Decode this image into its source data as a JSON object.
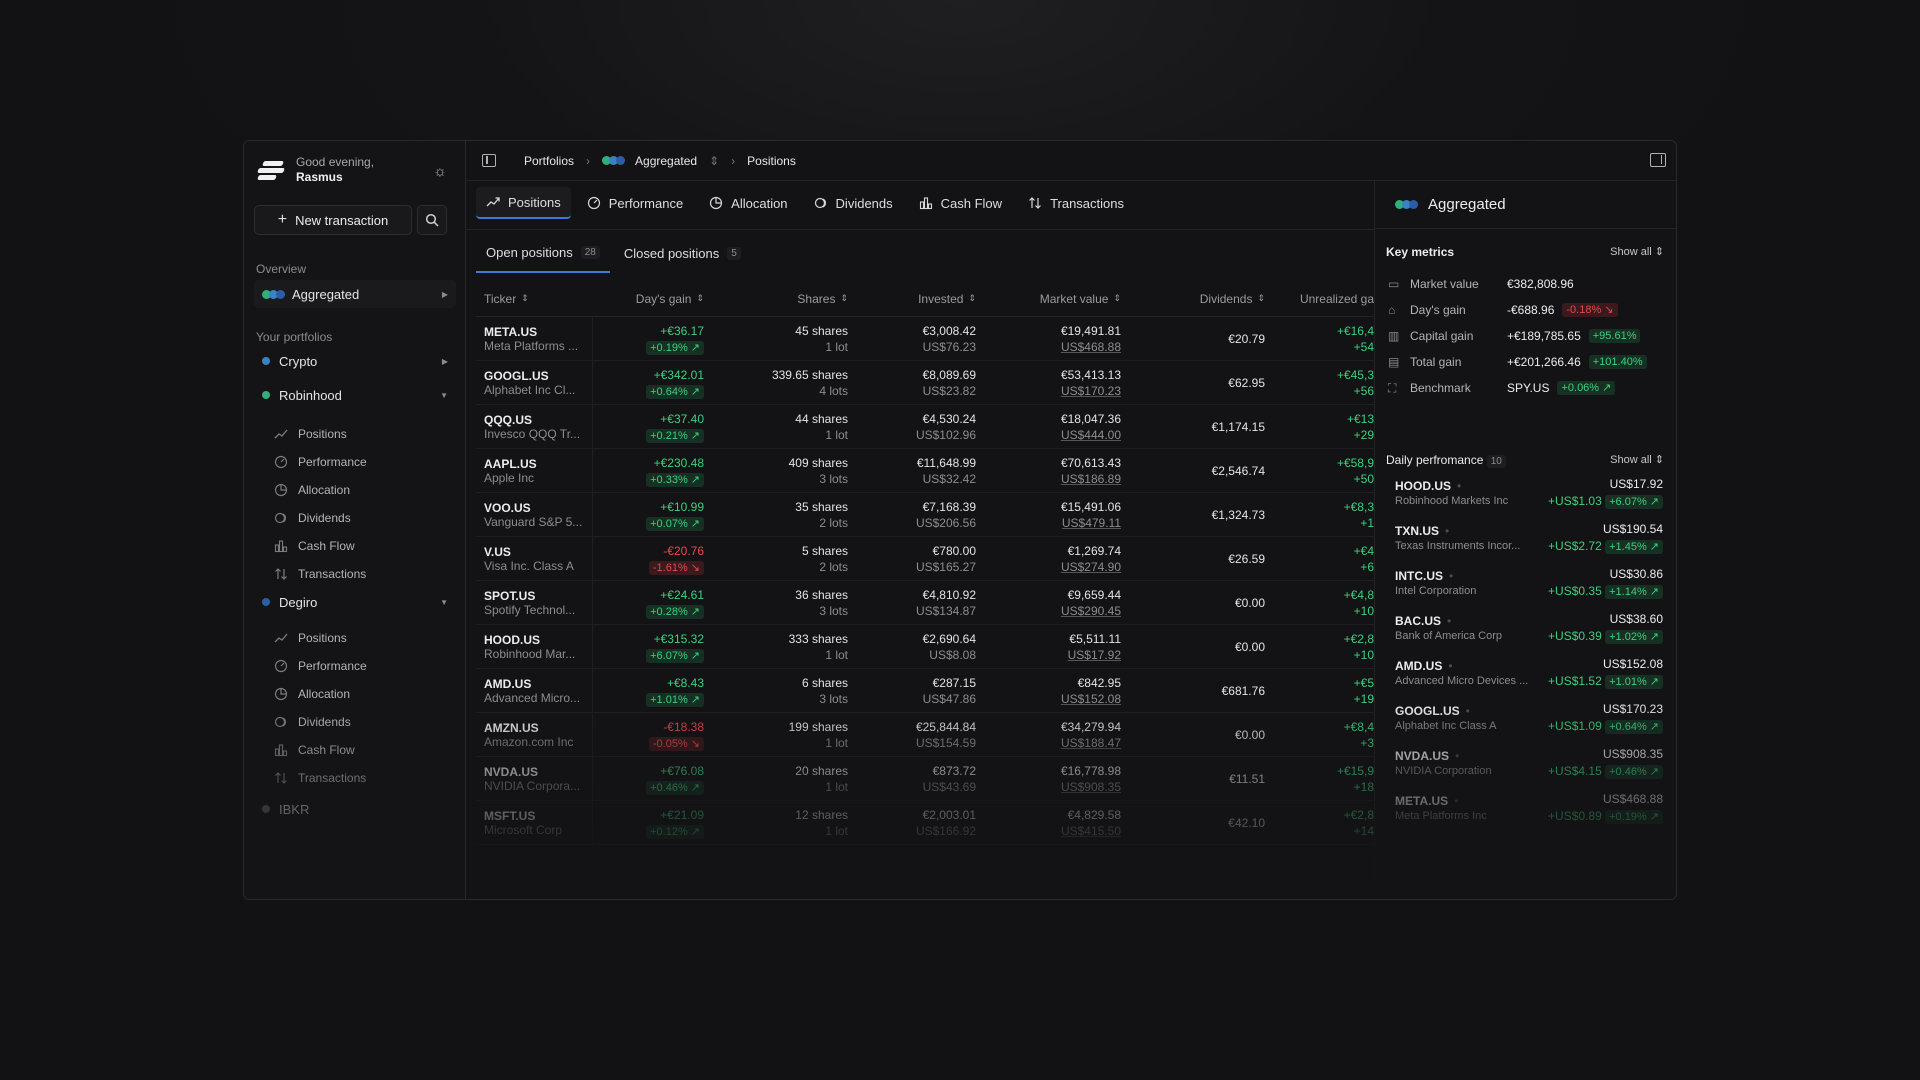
{
  "greeting": {
    "line1": "Good evening,",
    "name": "Rasmus"
  },
  "sidebar": {
    "new_transaction": "New transaction",
    "overview_label": "Overview",
    "aggregated_label": "Aggregated",
    "your_portfolios_label": "Your portfolios",
    "portfolios": [
      {
        "name": "Crypto",
        "color": "#3b82c4"
      },
      {
        "name": "Robinhood",
        "color": "#2fb07a"
      },
      {
        "name": "Degiro",
        "color": "#2a5fa8"
      },
      {
        "name": "IBKR",
        "color": "#6b6b70"
      }
    ],
    "sub_items": [
      "Positions",
      "Performance",
      "Allocation",
      "Dividends",
      "Cash Flow",
      "Transactions"
    ]
  },
  "breadcrumb": {
    "root": "Portfolios",
    "portfolio": "Aggregated",
    "page": "Positions"
  },
  "tabs": [
    "Positions",
    "Performance",
    "Allocation",
    "Dividends",
    "Cash Flow",
    "Transactions"
  ],
  "subtabs": {
    "open": "Open positions",
    "open_count": "28",
    "closed": "Closed positions",
    "closed_count": "5"
  },
  "table": {
    "headers": [
      "Ticker",
      "Day's gain",
      "Shares",
      "Invested",
      "Market value",
      "Dividends",
      "Unrealized ga"
    ],
    "rows": [
      {
        "ticker": "META.US",
        "name": "Meta Platforms ...",
        "gain": "+€36.17",
        "gain_pct": "+0.19% ↗",
        "shares": "45 shares",
        "lots": "1 lot",
        "invested": "€3,008.42",
        "avg": "US$76.23",
        "mv": "€19,491.81",
        "price": "US$468.88",
        "div": "€20.79",
        "unr": "+€16,4",
        "unr2": "+54",
        "dir": "pos"
      },
      {
        "ticker": "GOOGL.US",
        "name": "Alphabet Inc Cl...",
        "gain": "+€342.01",
        "gain_pct": "+0.64% ↗",
        "shares": "339.65 shares",
        "lots": "4 lots",
        "invested": "€8,089.69",
        "avg": "US$23.82",
        "mv": "€53,413.13",
        "price": "US$170.23",
        "div": "€62.95",
        "unr": "+€45,3",
        "unr2": "+56",
        "dir": "pos"
      },
      {
        "ticker": "QQQ.US",
        "name": "Invesco QQQ Tr...",
        "gain": "+€37.40",
        "gain_pct": "+0.21% ↗",
        "shares": "44 shares",
        "lots": "1 lot",
        "invested": "€4,530.24",
        "avg": "US$102.96",
        "mv": "€18,047.36",
        "price": "US$444.00",
        "div": "€1,174.15",
        "unr": "+€13",
        "unr2": "+29",
        "dir": "pos"
      },
      {
        "ticker": "AAPL.US",
        "name": "Apple Inc",
        "gain": "+€230.48",
        "gain_pct": "+0.33% ↗",
        "shares": "409 shares",
        "lots": "3 lots",
        "invested": "€11,648.99",
        "avg": "US$32.42",
        "mv": "€70,613.43",
        "price": "US$186.89",
        "div": "€2,546.74",
        "unr": "+€58,9",
        "unr2": "+50",
        "dir": "pos"
      },
      {
        "ticker": "VOO.US",
        "name": "Vanguard S&P 5...",
        "gain": "+€10.99",
        "gain_pct": "+0.07% ↗",
        "shares": "35 shares",
        "lots": "2 lots",
        "invested": "€7,168.39",
        "avg": "US$206.56",
        "mv": "€15,491.06",
        "price": "US$479.11",
        "div": "€1,324.73",
        "unr": "+€8,3",
        "unr2": "+1",
        "dir": "pos"
      },
      {
        "ticker": "V.US",
        "name": "Visa Inc. Class A",
        "gain": "-€20.76",
        "gain_pct": "-1.61% ↘",
        "shares": "5 shares",
        "lots": "2 lots",
        "invested": "€780.00",
        "avg": "US$165.27",
        "mv": "€1,269.74",
        "price": "US$274.90",
        "div": "€26.59",
        "unr": "+€4",
        "unr2": "+6",
        "dir": "neg"
      },
      {
        "ticker": "SPOT.US",
        "name": "Spotify Technol...",
        "gain": "+€24.61",
        "gain_pct": "+0.28% ↗",
        "shares": "36 shares",
        "lots": "3 lots",
        "invested": "€4,810.92",
        "avg": "US$134.87",
        "mv": "€9,659.44",
        "price": "US$290.45",
        "div": "€0.00",
        "unr": "+€4,8",
        "unr2": "+10",
        "dir": "pos"
      },
      {
        "ticker": "HOOD.US",
        "name": "Robinhood Mar...",
        "gain": "+€315.32",
        "gain_pct": "+6.07% ↗",
        "shares": "333 shares",
        "lots": "1 lot",
        "invested": "€2,690.64",
        "avg": "US$8.08",
        "mv": "€5,511.11",
        "price": "US$17.92",
        "div": "€0.00",
        "unr": "+€2,8",
        "unr2": "+10",
        "dir": "pos"
      },
      {
        "ticker": "AMD.US",
        "name": "Advanced Micro...",
        "gain": "+€8.43",
        "gain_pct": "+1.01% ↗",
        "shares": "6 shares",
        "lots": "3 lots",
        "invested": "€287.15",
        "avg": "US$47.86",
        "mv": "€842.95",
        "price": "US$152.08",
        "div": "€681.76",
        "unr": "+€5",
        "unr2": "+19",
        "dir": "pos"
      },
      {
        "ticker": "AMZN.US",
        "name": "Amazon.com Inc",
        "gain": "-€18.38",
        "gain_pct": "-0.05% ↘",
        "shares": "199 shares",
        "lots": "1 lot",
        "invested": "€25,844.84",
        "avg": "US$154.59",
        "mv": "€34,279.94",
        "price": "US$188.47",
        "div": "€0.00",
        "unr": "+€8,4",
        "unr2": "+3",
        "dir": "neg"
      },
      {
        "ticker": "NVDA.US",
        "name": "NVIDIA Corpora...",
        "gain": "+€76.08",
        "gain_pct": "+0.46% ↗",
        "shares": "20 shares",
        "lots": "1 lot",
        "invested": "€873.72",
        "avg": "US$43.69",
        "mv": "€16,778.98",
        "price": "US$908.35",
        "div": "€11.51",
        "unr": "+€15,9",
        "unr2": "+18",
        "dir": "pos"
      },
      {
        "ticker": "MSFT.US",
        "name": "Microsoft Corp",
        "gain": "+€21.09",
        "gain_pct": "+0.12% ↗",
        "shares": "12 shares",
        "lots": "1 lot",
        "invested": "€2,003.01",
        "avg": "US$166.92",
        "mv": "€4,829.58",
        "price": "US$415.50",
        "div": "€42.10",
        "unr": "+€2,8",
        "unr2": "+14",
        "dir": "pos"
      }
    ]
  },
  "right_panel": {
    "title": "Aggregated",
    "key_metrics_label": "Key metrics",
    "show_all": "Show all",
    "metrics": [
      {
        "label": "Market value",
        "value": "€382,808.96",
        "chip": "",
        "dir": "none",
        "icon": "wallet-icon"
      },
      {
        "label": "Day's gain",
        "value": "-€688.96",
        "chip": "-0.18% ↘",
        "dir": "neg",
        "icon": "chart-icon"
      },
      {
        "label": "Capital gain",
        "value": "+€189,785.65",
        "chip": "+95.61%",
        "dir": "pos",
        "icon": "capital-icon"
      },
      {
        "label": "Total gain",
        "value": "+€201,266.46",
        "chip": "+101.40%",
        "dir": "pos",
        "icon": "total-icon"
      },
      {
        "label": "Benchmark",
        "value": "SPY.US",
        "chip": "+0.06% ↗",
        "dir": "pos",
        "icon": "benchmark-icon"
      }
    ],
    "daily_label": "Daily perfromance",
    "daily_count": "10",
    "daily": [
      {
        "ticker": "HOOD.US",
        "name": "Robinhood Markets Inc",
        "price": "US$17.92",
        "gain": "+US$1.03",
        "pct": "+6.07% ↗"
      },
      {
        "ticker": "TXN.US",
        "name": "Texas Instruments Incor...",
        "price": "US$190.54",
        "gain": "+US$2.72",
        "pct": "+1.45% ↗"
      },
      {
        "ticker": "INTC.US",
        "name": "Intel Corporation",
        "price": "US$30.86",
        "gain": "+US$0.35",
        "pct": "+1.14% ↗"
      },
      {
        "ticker": "BAC.US",
        "name": "Bank of America Corp",
        "price": "US$38.60",
        "gain": "+US$0.39",
        "pct": "+1.02% ↗"
      },
      {
        "ticker": "AMD.US",
        "name": "Advanced Micro Devices ...",
        "price": "US$152.08",
        "gain": "+US$1.52",
        "pct": "+1.01% ↗"
      },
      {
        "ticker": "GOOGL.US",
        "name": "Alphabet Inc Class A",
        "price": "US$170.23",
        "gain": "+US$1.09",
        "pct": "+0.64% ↗"
      },
      {
        "ticker": "NVDA.US",
        "name": "NVIDIA Corporation",
        "price": "US$908.35",
        "gain": "+US$4.15",
        "pct": "+0.46% ↗"
      },
      {
        "ticker": "META.US",
        "name": "Meta Platforms Inc",
        "price": "US$468.88",
        "gain": "+US$0.89",
        "pct": "+0.19% ↗"
      }
    ]
  },
  "colors": {
    "accent": "#3e7bd6",
    "positive": "#3ecf7e",
    "negative": "#e5484d",
    "agg1": "#2fb07a",
    "agg2": "#3b82c4",
    "agg3": "#2a5fa8"
  }
}
